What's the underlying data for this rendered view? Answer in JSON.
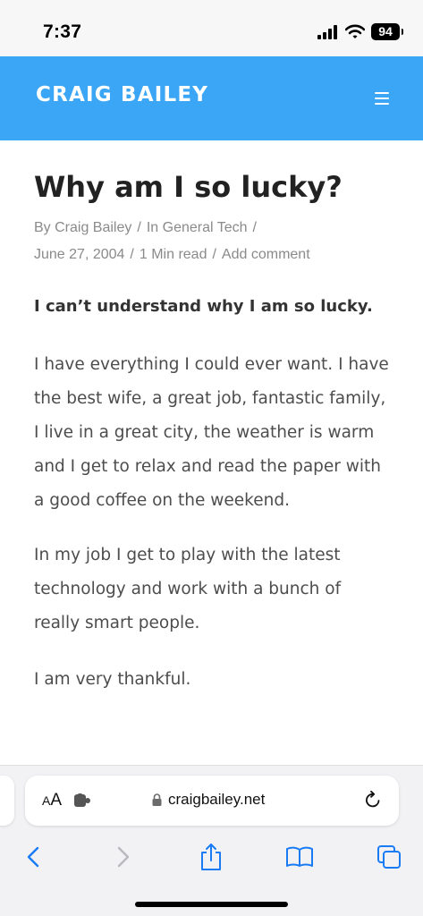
{
  "status_bar": {
    "time": "7:37",
    "battery": "94"
  },
  "header": {
    "site_title": "CRAIG BAILEY",
    "menu_icon": "hamburger-menu-icon"
  },
  "article": {
    "title": "Why am I so lucky?",
    "author": "By Craig Bailey",
    "category": "In General Tech",
    "date": "June 27, 2004",
    "read_time": "1 Min read",
    "comment_link": "Add comment",
    "separator": "/",
    "lead": "I can’t understand why I am so lucky.",
    "paragraphs": [
      "I have everything I could ever want. I have the best wife, a great job, fantastic family, I live in a great city, the weather is warm and I get to relax and read the paper with a good coffee on the weekend.",
      "In my job I get to play with the latest technology and work with a bunch of really smart people.",
      "I am very thankful."
    ]
  },
  "browser": {
    "aa_small": "A",
    "aa_big": "A",
    "url": "craigbailey.net",
    "icons": [
      "extension-icon",
      "lock-icon",
      "reload-icon",
      "back-icon",
      "forward-icon",
      "share-icon",
      "bookmarks-icon",
      "tabs-icon"
    ],
    "accent": "#1a7cf5",
    "header_color": "#3aa6f5"
  }
}
